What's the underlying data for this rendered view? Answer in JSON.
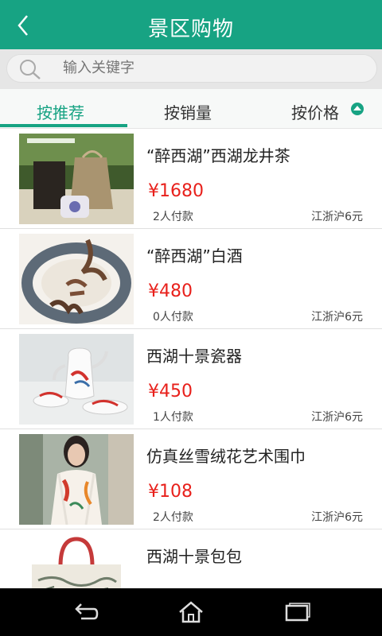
{
  "header": {
    "title": "景区购物",
    "back_icon": "back-arrow-icon"
  },
  "search": {
    "placeholder": "输入关键字",
    "value": ""
  },
  "tabs": [
    {
      "label": "按推荐",
      "active": true
    },
    {
      "label": "按销量",
      "active": false
    },
    {
      "label": "按价格",
      "active": false,
      "icon": "sort-up-icon"
    }
  ],
  "products": [
    {
      "title": "“醉西湖”西湖龙井茶",
      "price": "¥1680",
      "sold": "2人付款",
      "shipping": "江浙沪6元"
    },
    {
      "title": "“醉西湖”白酒",
      "price": "¥480",
      "sold": "0人付款",
      "shipping": "江浙沪6元"
    },
    {
      "title": "西湖十景瓷器",
      "price": "¥450",
      "sold": "1人付款",
      "shipping": "江浙沪6元"
    },
    {
      "title": "仿真丝雪绒花艺术围巾",
      "price": "¥108",
      "sold": "2人付款",
      "shipping": "江浙沪6元"
    },
    {
      "title": "西湖十景包包",
      "price": "",
      "sold": "",
      "shipping": ""
    }
  ],
  "navbar": {
    "icons": [
      "back-icon",
      "home-icon",
      "recent-apps-icon"
    ]
  },
  "colors": {
    "primary": "#17a383",
    "price": "#e8201b"
  }
}
